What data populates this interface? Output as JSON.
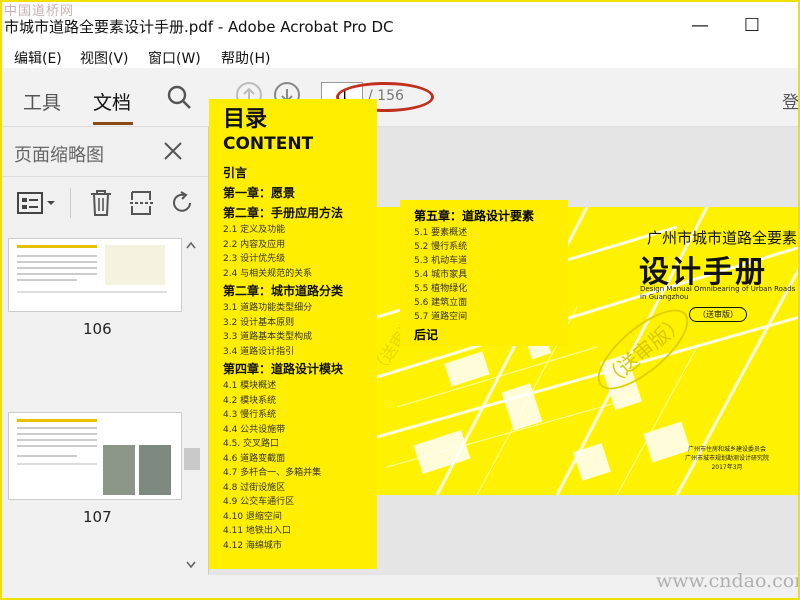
{
  "window": {
    "title": "市城市道路全要素设计手册.pdf - Adobe Acrobat Pro DC",
    "watermark": "中国道桥网",
    "minimize": "—",
    "maximize": "☐"
  },
  "menu": [
    "编辑(E)",
    "视图(V)",
    "窗口(W)",
    "帮助(H)"
  ],
  "toolbar": {
    "tabs": [
      "工具",
      "文档"
    ],
    "active_tab": "文档",
    "page_current": "1",
    "page_total": "/ 156",
    "login": "登"
  },
  "side_panel": {
    "title": "页面缩略图",
    "thumbnails": [
      {
        "page": "106"
      },
      {
        "page": "107"
      }
    ]
  },
  "toc": {
    "title_cn": "目录",
    "title_en": "CONTENT",
    "intro": "引言",
    "ch1": "第一章：愿景",
    "ch2a": "第二章：手册应用方法",
    "ch2a_items": [
      "2.1 定义及功能",
      "2.2 内容及应用",
      "2.3 设计优先级",
      "2.4 与相关规范的关系"
    ],
    "ch2b": "第二章：城市道路分类",
    "ch2b_items": [
      "3.1 道路功能类型细分",
      "3.2 设计基本原则",
      "3.3 道路基本类型构成",
      "3.4 道路设计指引"
    ],
    "ch4": "第四章：道路设计模块",
    "ch4_items": [
      "4.1 模块概述",
      "4.2 模块系统",
      "4.3 慢行系统",
      "4.4 公共设施带",
      "4.5. 交叉路口",
      "4.6 道路变截面",
      "4.7 多杆合一、多箱并集",
      "4.8 过街设施区",
      "4.9 公交车通行区",
      "4.10 退缩空间",
      "4.11 地铁出入口",
      "4.12 海绵城市"
    ],
    "ch5": "第五章：道路设计要素",
    "ch5_items": [
      "5.1 要素概述",
      "5.2 慢行系统",
      "5.3 机动车道",
      "5.4 城市家具",
      "5.5 植物绿化",
      "5.6 建筑立面",
      "5.7 道路空间"
    ],
    "epilogue": "后记"
  },
  "cover": {
    "title_cn": "广州市城市道路全要素",
    "big_title": "设计手册",
    "en": "Design Manual Omnibearing of Urban Roads in Guangzhou",
    "tag": "（送审版）",
    "stamp1": "（送审版）",
    "stamp2": "（送审版）",
    "foot1": "广州市住房和城乡建设委员会",
    "foot2": "广州市城市规划勘测设计研究院",
    "foot3": "2017年3月"
  },
  "bottom_watermark": "www.cndao.com",
  "colors": {
    "accent_yellow": "#ffee00",
    "tab_underline": "#8a4a14",
    "annotation_red": "#c0301c"
  }
}
